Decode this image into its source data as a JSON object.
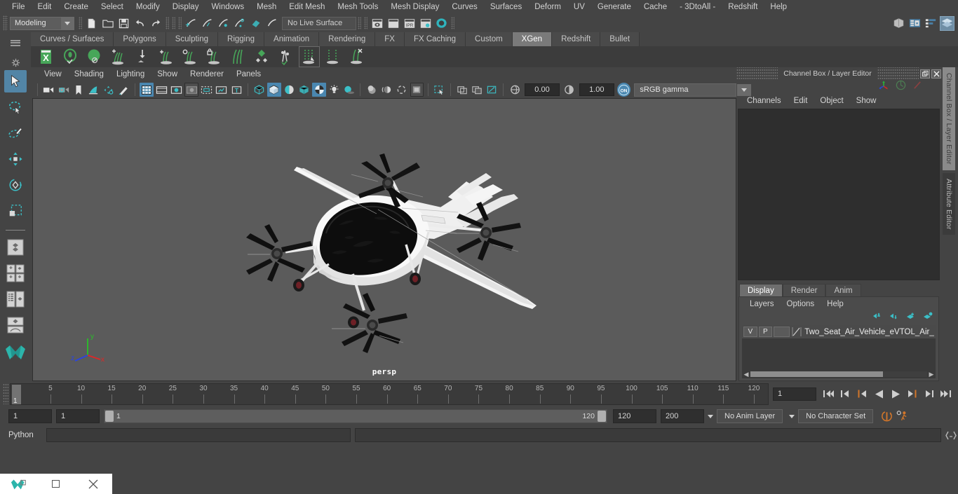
{
  "app": {
    "name": "Autodesk Maya"
  },
  "menubar": {
    "items": [
      "File",
      "Edit",
      "Create",
      "Select",
      "Modify",
      "Display",
      "Windows",
      "Mesh",
      "Edit Mesh",
      "Mesh Tools",
      "Mesh Display",
      "Curves",
      "Surfaces",
      "Deform",
      "UV",
      "Generate",
      "Cache",
      "- 3DtoAll -",
      "Redshift",
      "Help"
    ]
  },
  "statusbar": {
    "mode": "Modeling",
    "live_surface": "No Live Surface",
    "icons": [
      "new-scene-icon",
      "open-scene-icon",
      "save-scene-icon",
      "undo-icon",
      "redo-icon",
      "select-by-hierarchy-icon",
      "select-by-object-icon",
      "select-by-component-icon",
      "snap-to-grid-icon",
      "snap-to-curve-icon",
      "snap-to-point-icon",
      "snap-to-projected-center-icon",
      "snap-to-view-plane-icon",
      "make-live-icon"
    ],
    "right_icons": [
      "render-view-icon",
      "render-sequence-icon",
      "ipr-render-icon",
      "render-settings-icon",
      "hypershade-icon"
    ],
    "panel_icons": [
      "show-hide-modeling-toolkit-icon",
      "show-hide-attribute-editor-icon",
      "show-hide-tool-settings-icon",
      "show-hide-channel-box-icon"
    ]
  },
  "shelf": {
    "tabs": [
      "Curves / Surfaces",
      "Polygons",
      "Sculpting",
      "Rigging",
      "Animation",
      "Rendering",
      "FX",
      "FX Caching",
      "Custom",
      "XGen",
      "Redshift",
      "Bullet"
    ],
    "active_tab": "XGen",
    "icons": [
      "xgen-editor-icon",
      "xgen-preview-icon",
      "xgen-sphere-icon",
      "xgen-add-guides-icon",
      "xgen-place-icon",
      "xgen-add-grooming-icon",
      "xgen-circle-guide-icon",
      "xgen-lock-guide-icon",
      "xgen-comb-icon",
      "xgen-density-icon",
      "xgen-clump-icon",
      "xgen-cut-icon",
      "xgen-region-icon",
      "xgen-delete-icon"
    ]
  },
  "toolbox": {
    "tools": [
      "select-tool",
      "lasso-select-tool",
      "paint-select-tool",
      "move-tool",
      "rotate-tool",
      "scale-tool"
    ],
    "active_tool": "select-tool",
    "layouts": [
      "single-perspective-layout",
      "four-view-layout",
      "outliner-persp-layout",
      "hypershade-persp-layout",
      "maya-logo"
    ]
  },
  "viewport": {
    "menus": [
      "View",
      "Shading",
      "Lighting",
      "Show",
      "Renderer",
      "Panels"
    ],
    "camera_label": "persp",
    "toolbar": {
      "exposure": "0.00",
      "gamma": "1.00",
      "color_space": "sRGB gamma",
      "icons": [
        "select-camera-icon",
        "camera-attributes-icon",
        "bookmark-icon",
        "image-plane-icon",
        "2d-pan-zoom-icon",
        "grease-pencil-icon",
        "grid-toggle-icon",
        "film-gate-icon",
        "resolution-gate-icon",
        "gate-mask-icon",
        "film-origin-icon",
        "safe-action-icon",
        "text-overlay-icon",
        "wireframe-icon",
        "smooth-shade-all-icon",
        "flat-shade-icon",
        "shaded-wireframe-icon",
        "textured-icon",
        "use-all-lights-icon",
        "shadows-icon",
        "screen-space-ambient-occlusion-icon",
        "motion-blur-icon",
        "multisample-anti-aliasing-icon",
        "depth-of-field-icon",
        "isolate-select-icon",
        "xray-icon",
        "xray-joints-icon",
        "xray-active-components-icon",
        "exposure-icon",
        "gamma-icon",
        "color-management-icon"
      ]
    },
    "axis_labels": {
      "x": "x",
      "y": "y",
      "z": "z"
    },
    "model": "Two seat eVTOL air vehicle"
  },
  "channel_box": {
    "title": "Channel Box / Layer Editor",
    "menus": [
      "Channels",
      "Edit",
      "Object",
      "Show"
    ],
    "toolbar_icons": [
      "channel-box-icon",
      "attribute-editor-icon",
      "tool-settings-icon"
    ],
    "window_buttons": [
      "undock-icon",
      "close-icon"
    ]
  },
  "layer_editor": {
    "tabs": [
      "Display",
      "Render",
      "Anim"
    ],
    "active_tab": "Display",
    "menus": [
      "Layers",
      "Options",
      "Help"
    ],
    "toolbar_icons": [
      "move-layer-up-icon",
      "move-layer-down-icon",
      "create-empty-layer-icon",
      "create-layer-from-selected-icon"
    ],
    "layers": [
      {
        "visibility": "V",
        "playback": "P",
        "type": "",
        "name": "Two_Seat_Air_Vehicle_eVTOL_Air_On"
      }
    ]
  },
  "vertical_tabs": [
    "Channel Box / Layer Editor",
    "Attribute Editor"
  ],
  "timeline": {
    "start": 1,
    "end": 120,
    "current_frame": "1",
    "tick_labels": [
      5,
      10,
      15,
      20,
      25,
      30,
      35,
      40,
      45,
      50,
      55,
      60,
      65,
      70,
      75,
      80,
      85,
      90,
      95,
      100,
      105,
      110,
      115,
      120
    ],
    "playback_buttons": [
      "go-to-start-icon",
      "step-back-frame-icon",
      "step-back-key-icon",
      "play-backwards-icon",
      "play-forwards-icon",
      "step-forward-key-icon",
      "step-forward-frame-icon",
      "go-to-end-icon"
    ]
  },
  "range_slider": {
    "anim_start": "1",
    "range_start": "1",
    "bar_start_label": "1",
    "bar_end_label": "120",
    "range_end": "120",
    "anim_end": "200",
    "anim_layer": "No Anim Layer",
    "character_set": "No Character Set",
    "right_icons": [
      "auto-key-icon",
      "animation-preferences-icon"
    ]
  },
  "command_line": {
    "language": "Python",
    "input_value": "",
    "output_value": "",
    "help_icon": "script-editor-icon"
  },
  "taskbar": {
    "items": [
      "maya-app-icon",
      "restore-window-icon",
      "close-window-icon"
    ]
  },
  "colors": {
    "accent_teal": "#35b6c0",
    "accent_blue": "#4a87b0",
    "panel_bg": "#444444",
    "viewport_bg": "#5b5b5b",
    "field_bg": "#2f2f2f",
    "orange": "#d2762a"
  }
}
